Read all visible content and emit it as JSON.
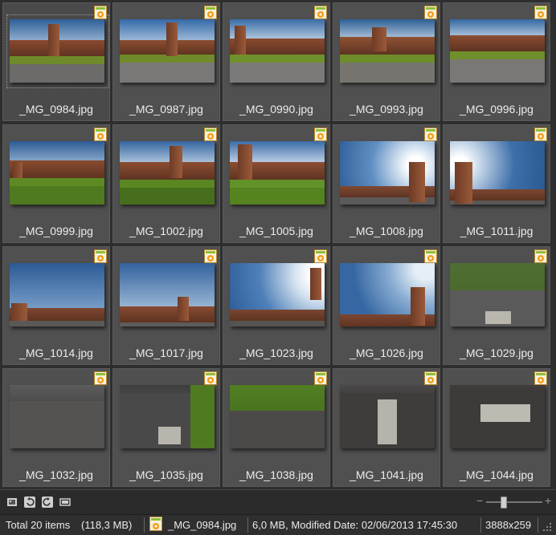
{
  "gallery": {
    "items": [
      {
        "name": "_MG_0984.jpg",
        "scene": "courtyard-a",
        "selected": true
      },
      {
        "name": "_MG_0987.jpg",
        "scene": "courtyard-b"
      },
      {
        "name": "_MG_0990.jpg",
        "scene": "courtyard-c"
      },
      {
        "name": "_MG_0993.jpg",
        "scene": "courtyard-d"
      },
      {
        "name": "_MG_0996.jpg",
        "scene": "courtyard-e"
      },
      {
        "name": "_MG_0999.jpg",
        "scene": "wall-lawn"
      },
      {
        "name": "_MG_1002.jpg",
        "scene": "wall-tower-lawn"
      },
      {
        "name": "_MG_1005.jpg",
        "scene": "tower-lawn"
      },
      {
        "name": "_MG_1008.jpg",
        "scene": "sun-tower"
      },
      {
        "name": "_MG_1011.jpg",
        "scene": "sky-towers"
      },
      {
        "name": "_MG_1014.jpg",
        "scene": "sky-wall"
      },
      {
        "name": "_MG_1017.jpg",
        "scene": "sky-tower-wall"
      },
      {
        "name": "_MG_1023.jpg",
        "scene": "sun-tilt"
      },
      {
        "name": "_MG_1026.jpg",
        "scene": "sky-tower-right"
      },
      {
        "name": "_MG_1029.jpg",
        "scene": "path-slab"
      },
      {
        "name": "_MG_1032.jpg",
        "scene": "pavement"
      },
      {
        "name": "_MG_1035.jpg",
        "scene": "path-slab-low"
      },
      {
        "name": "_MG_1038.jpg",
        "scene": "lawn-pavement"
      },
      {
        "name": "_MG_1041.jpg",
        "scene": "brick-slab"
      },
      {
        "name": "_MG_1044.jpg",
        "scene": "brick-slab-feet"
      }
    ],
    "badge_icon": "jpg-file-icon",
    "accent": "#f39c12"
  },
  "toolbar": {
    "buttons": [
      "slideshow-icon",
      "rotate-left-icon",
      "rotate-right-icon",
      "fullscreen-icon"
    ],
    "zoom_minus": "−",
    "zoom_plus": "+"
  },
  "status": {
    "total": "Total 20 items",
    "size": "(118,3 MB)",
    "current_file": "_MG_0984.jpg",
    "file_info": "6,0 MB, Modified Date: 02/06/2013 17:45:30",
    "dimensions": "3888x259"
  }
}
